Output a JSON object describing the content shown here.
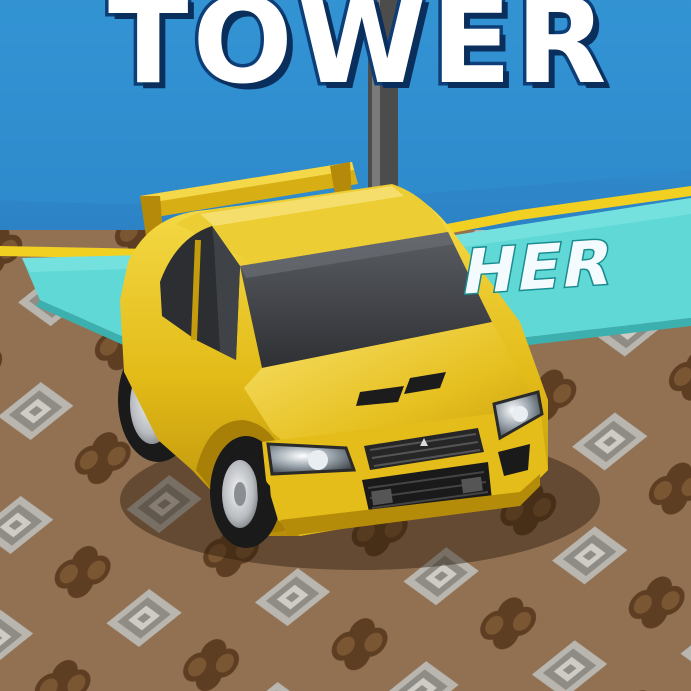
{
  "scene": {
    "sign_text": "TOWER",
    "banner_text": "HER",
    "colors": {
      "sky_blue": "#2f8fd0",
      "banner_teal": "#5fd8d6",
      "floor_brown": "#8a6a4c",
      "car_yellow": "#e8c21e",
      "sign_outline": "#0d3e78"
    },
    "objects": [
      "tower-sign",
      "pole",
      "teal-banner",
      "patterned-floor",
      "yellow-car"
    ]
  }
}
